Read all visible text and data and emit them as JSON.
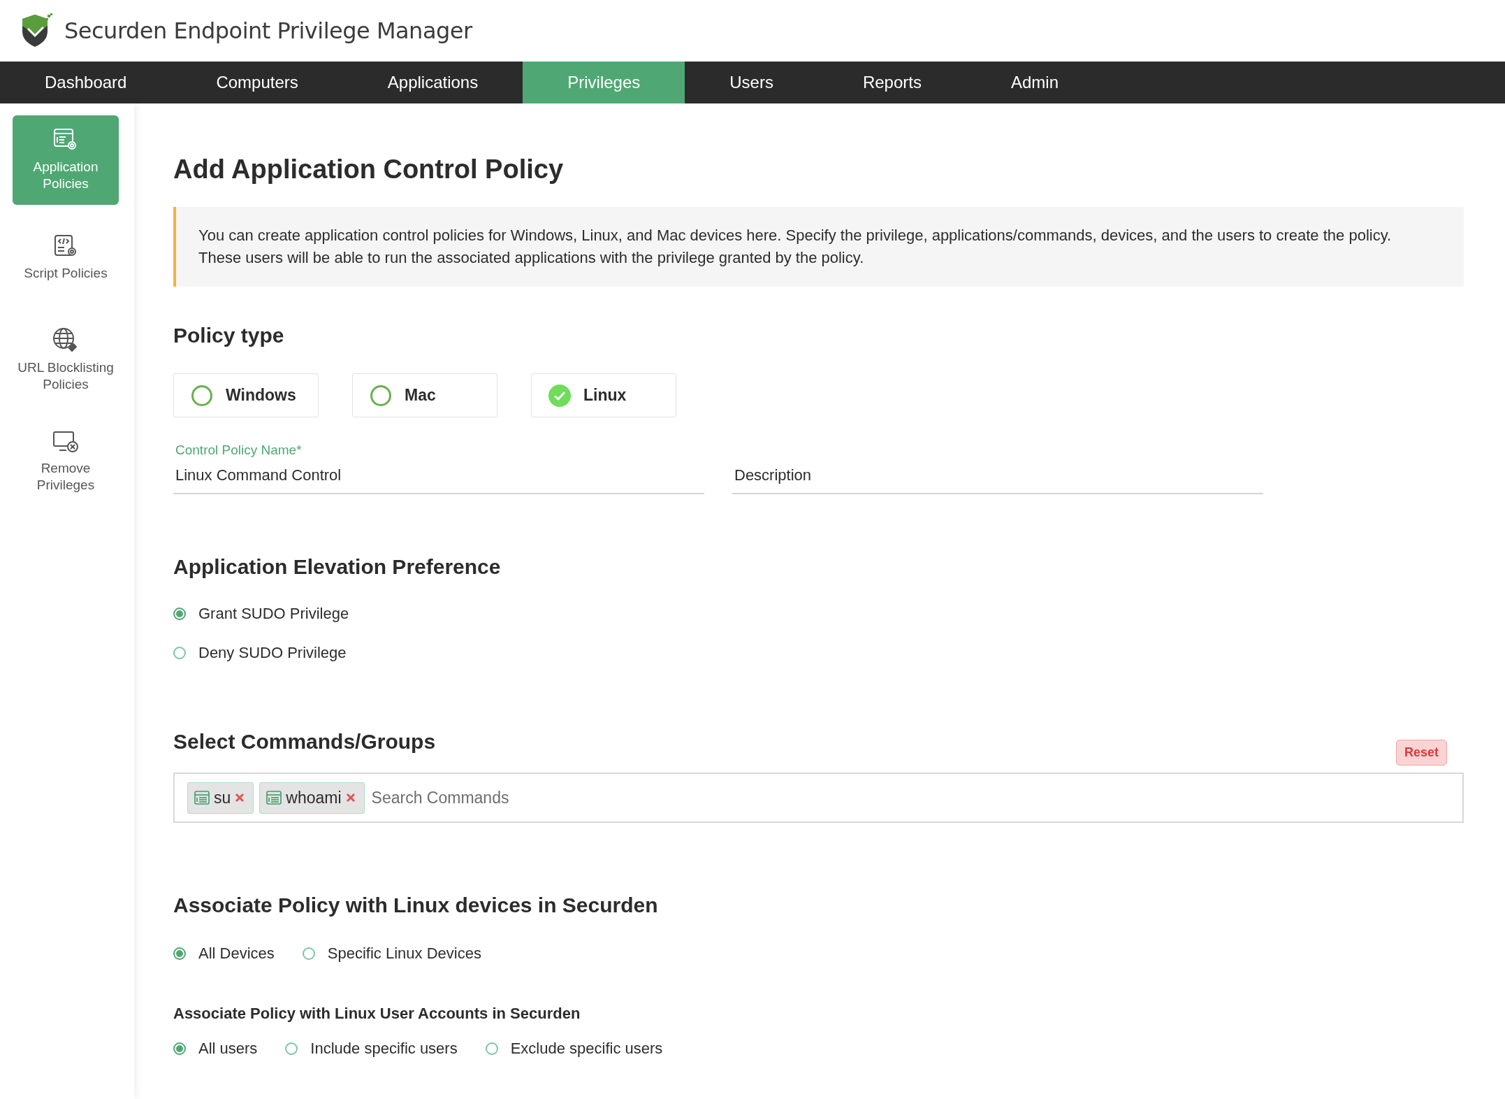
{
  "app": {
    "title": "Securden Endpoint Privilege Manager"
  },
  "nav": [
    {
      "label": "Dashboard",
      "selected": false
    },
    {
      "label": "Computers",
      "selected": false
    },
    {
      "label": "Applications",
      "selected": false
    },
    {
      "label": "Privileges",
      "selected": true
    },
    {
      "label": "Users",
      "selected": false
    },
    {
      "label": "Reports",
      "selected": false
    },
    {
      "label": "Admin",
      "selected": false
    }
  ],
  "sidebar": [
    {
      "label": "Application Policies",
      "selected": true
    },
    {
      "label": "Script Policies",
      "selected": false
    },
    {
      "label": "URL Blocklisting Policies",
      "selected": false
    },
    {
      "label": "Remove Privileges",
      "selected": false
    }
  ],
  "page": {
    "title": "Add Application Control Policy",
    "info": "You can create application control policies for Windows, Linux, and Mac devices here. Specify the privilege, applications/commands, devices, and the users to create the policy. These users will be able to run the associated applications with the privilege granted by the policy."
  },
  "policy_type": {
    "heading": "Policy type",
    "options": [
      {
        "label": "Windows",
        "selected": false
      },
      {
        "label": "Mac",
        "selected": false
      },
      {
        "label": "Linux",
        "selected": true
      }
    ]
  },
  "name_field": {
    "label": "Control Policy Name*",
    "value": "Linux Command Control"
  },
  "description_field": {
    "placeholder": "Description"
  },
  "elevation": {
    "heading": "Application Elevation Preference",
    "options": [
      {
        "label": "Grant SUDO Privilege",
        "selected": true
      },
      {
        "label": "Deny SUDO Privilege",
        "selected": false
      }
    ]
  },
  "commands": {
    "heading": "Select Commands/Groups",
    "reset": "Reset",
    "chips": [
      {
        "label": "su"
      },
      {
        "label": "whoami"
      }
    ],
    "placeholder": "Search Commands"
  },
  "devices": {
    "heading": "Associate Policy with Linux devices in Securden",
    "options": [
      {
        "label": "All Devices",
        "selected": true
      },
      {
        "label": "Specific Linux Devices",
        "selected": false
      }
    ]
  },
  "users": {
    "heading": "Associate Policy with Linux User Accounts in Securden",
    "options": [
      {
        "label": "All users",
        "selected": true
      },
      {
        "label": "Include specific users",
        "selected": false
      },
      {
        "label": "Exclude specific users",
        "selected": false
      }
    ]
  }
}
